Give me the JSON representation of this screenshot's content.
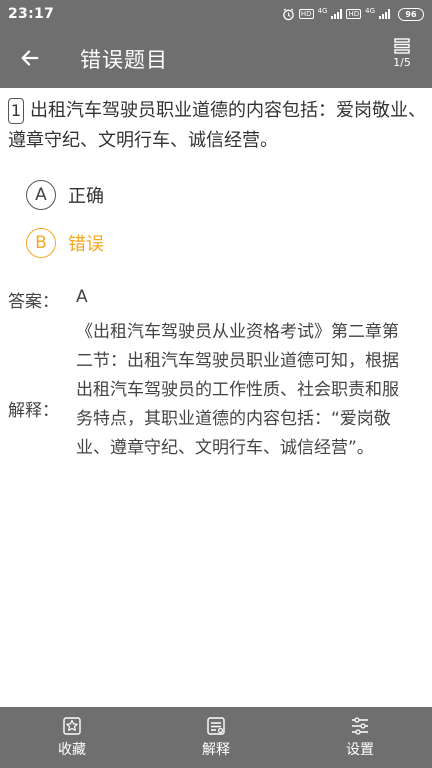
{
  "status_bar": {
    "time": "23:17",
    "network_1": "4G",
    "network_2": "4G",
    "hd_1": "HD",
    "hd_2": "HD",
    "battery": "96"
  },
  "app_bar": {
    "title": "错误题目",
    "progress": "1/5"
  },
  "question": {
    "number": "1",
    "text": "出租汽车驾驶员职业道德的内容包括：爱岗敬业、遵章守纪、文明行车、诚信经营。",
    "options": [
      {
        "key": "A",
        "text": "正确",
        "state": "normal"
      },
      {
        "key": "B",
        "text": "错误",
        "state": "selected-wrong"
      }
    ]
  },
  "answer": {
    "label": "答案：",
    "value": "A"
  },
  "explanation": {
    "label": "解释：",
    "text": "《出租汽车驾驶员从业资格考试》第二章第二节：出租汽车驾驶员职业道德可知，根据出租汽车驾驶员的工作性质、社会职责和服务特点，其职业道德的内容包括：“爱岗敬业、遵章守纪、文明行车、诚信经营”。"
  },
  "bottom_bar": {
    "items": [
      {
        "label": "收藏",
        "icon": "star-icon"
      },
      {
        "label": "解释",
        "icon": "note-icon"
      },
      {
        "label": "设置",
        "icon": "sliders-icon"
      }
    ]
  },
  "colors": {
    "bar_background": "#6f6f6f",
    "wrong_accent": "#f5a623"
  }
}
